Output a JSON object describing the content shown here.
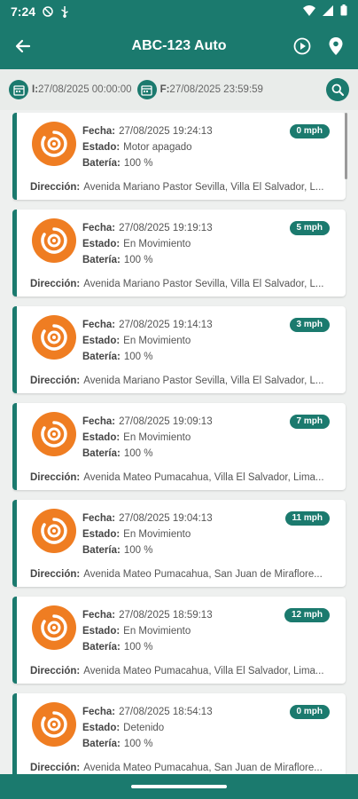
{
  "status": {
    "time": "7:24"
  },
  "header": {
    "title": "ABC-123 Auto"
  },
  "filter": {
    "start_label": "I:",
    "start_value": "27/08/2025 00:00:00",
    "end_label": "F:",
    "end_value": "27/08/2025 23:59:59"
  },
  "labels": {
    "fecha": "Fecha:",
    "estado": "Estado:",
    "bateria": "Batería:",
    "direccion": "Dirección:"
  },
  "colors": {
    "primary": "#1b7a6e",
    "accent_orange": "#ef7d22",
    "background": "#eef0ef"
  },
  "records": [
    {
      "fecha": "27/08/2025 19:24:13",
      "estado": "Motor apagado",
      "bateria": "100 %",
      "direccion": "Avenida Mariano Pastor Sevilla, Villa El Salvador, L...",
      "speed": "0 mph"
    },
    {
      "fecha": "27/08/2025 19:19:13",
      "estado": "En Movimiento",
      "bateria": "100 %",
      "direccion": "Avenida Mariano Pastor Sevilla, Villa El Salvador, L...",
      "speed": "5 mph"
    },
    {
      "fecha": "27/08/2025 19:14:13",
      "estado": "En Movimiento",
      "bateria": "100 %",
      "direccion": "Avenida Mariano Pastor Sevilla, Villa El Salvador, L...",
      "speed": "3 mph"
    },
    {
      "fecha": "27/08/2025 19:09:13",
      "estado": "En Movimiento",
      "bateria": "100 %",
      "direccion": "Avenida Mateo Pumacahua, Villa El Salvador, Lima...",
      "speed": "7 mph"
    },
    {
      "fecha": "27/08/2025 19:04:13",
      "estado": "En Movimiento",
      "bateria": "100 %",
      "direccion": "Avenida Mateo Pumacahua, San Juan de Miraflore...",
      "speed": "11 mph"
    },
    {
      "fecha": "27/08/2025 18:59:13",
      "estado": "En Movimiento",
      "bateria": "100 %",
      "direccion": "Avenida Mateo Pumacahua, Villa El Salvador, Lima...",
      "speed": "12 mph"
    },
    {
      "fecha": "27/08/2025 18:54:13",
      "estado": "Detenido",
      "bateria": "100 %",
      "direccion": "Avenida Mateo Pumacahua, San Juan de Miraflore...",
      "speed": "0 mph"
    }
  ]
}
